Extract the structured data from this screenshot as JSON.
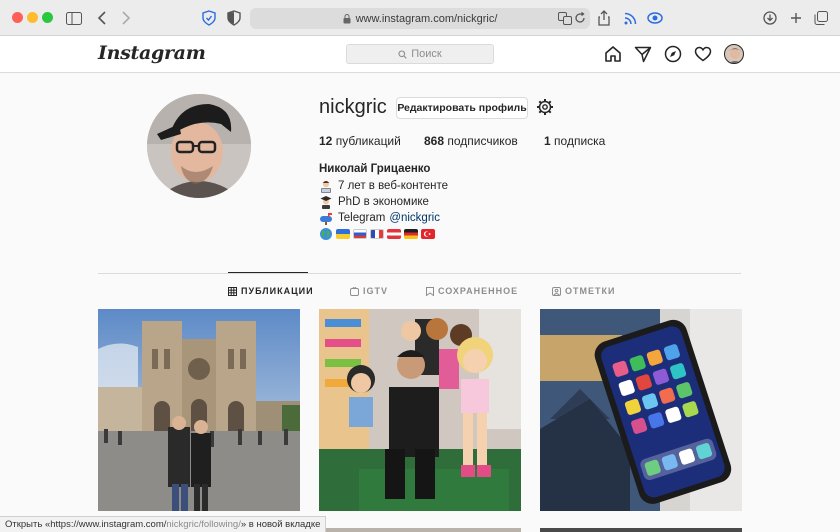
{
  "browser": {
    "url": "www.instagram.com/nickgric/",
    "colors": {
      "close": "#ff5f57",
      "minimize": "#febc2e",
      "zoom": "#28c840"
    },
    "icons": [
      "sidebar-icon",
      "back-icon",
      "forward-icon",
      "privacy-shield-icon",
      "reader-icon",
      "lock-icon",
      "translate-icon",
      "share-icon",
      "rss-icon",
      "extension-icon",
      "downloads-icon",
      "new-tab-icon",
      "tab-overview-icon"
    ]
  },
  "header": {
    "logo": "Instagram",
    "search_placeholder": "Поиск"
  },
  "profile": {
    "username": "nickgric",
    "edit_label": "Редактировать профиль",
    "stats": {
      "posts_count": "12",
      "posts_label": "публикаций",
      "followers_count": "868",
      "followers_label": "подписчиков",
      "following_count": "1",
      "following_label": "подписка"
    },
    "full_name": "Николай Грицаенко",
    "bio": {
      "line1": "7 лет в веб-контенте",
      "line2": "PhD в экономике",
      "line3_prefix": "Telegram",
      "line3_link": "@nickgric"
    }
  },
  "tabs": [
    {
      "label": "ПУБЛИКАЦИИ",
      "active": true
    },
    {
      "label": "IGTV",
      "active": false
    },
    {
      "label": "СОХРАНЕННОЕ",
      "active": false
    },
    {
      "label": "ОТМЕТКИ",
      "active": false
    }
  ],
  "statusbar": {
    "prefix": "Открыть «https://www.instagram.com/",
    "path": "nickgric/following/",
    "suffix": "» в новой вкладке"
  }
}
